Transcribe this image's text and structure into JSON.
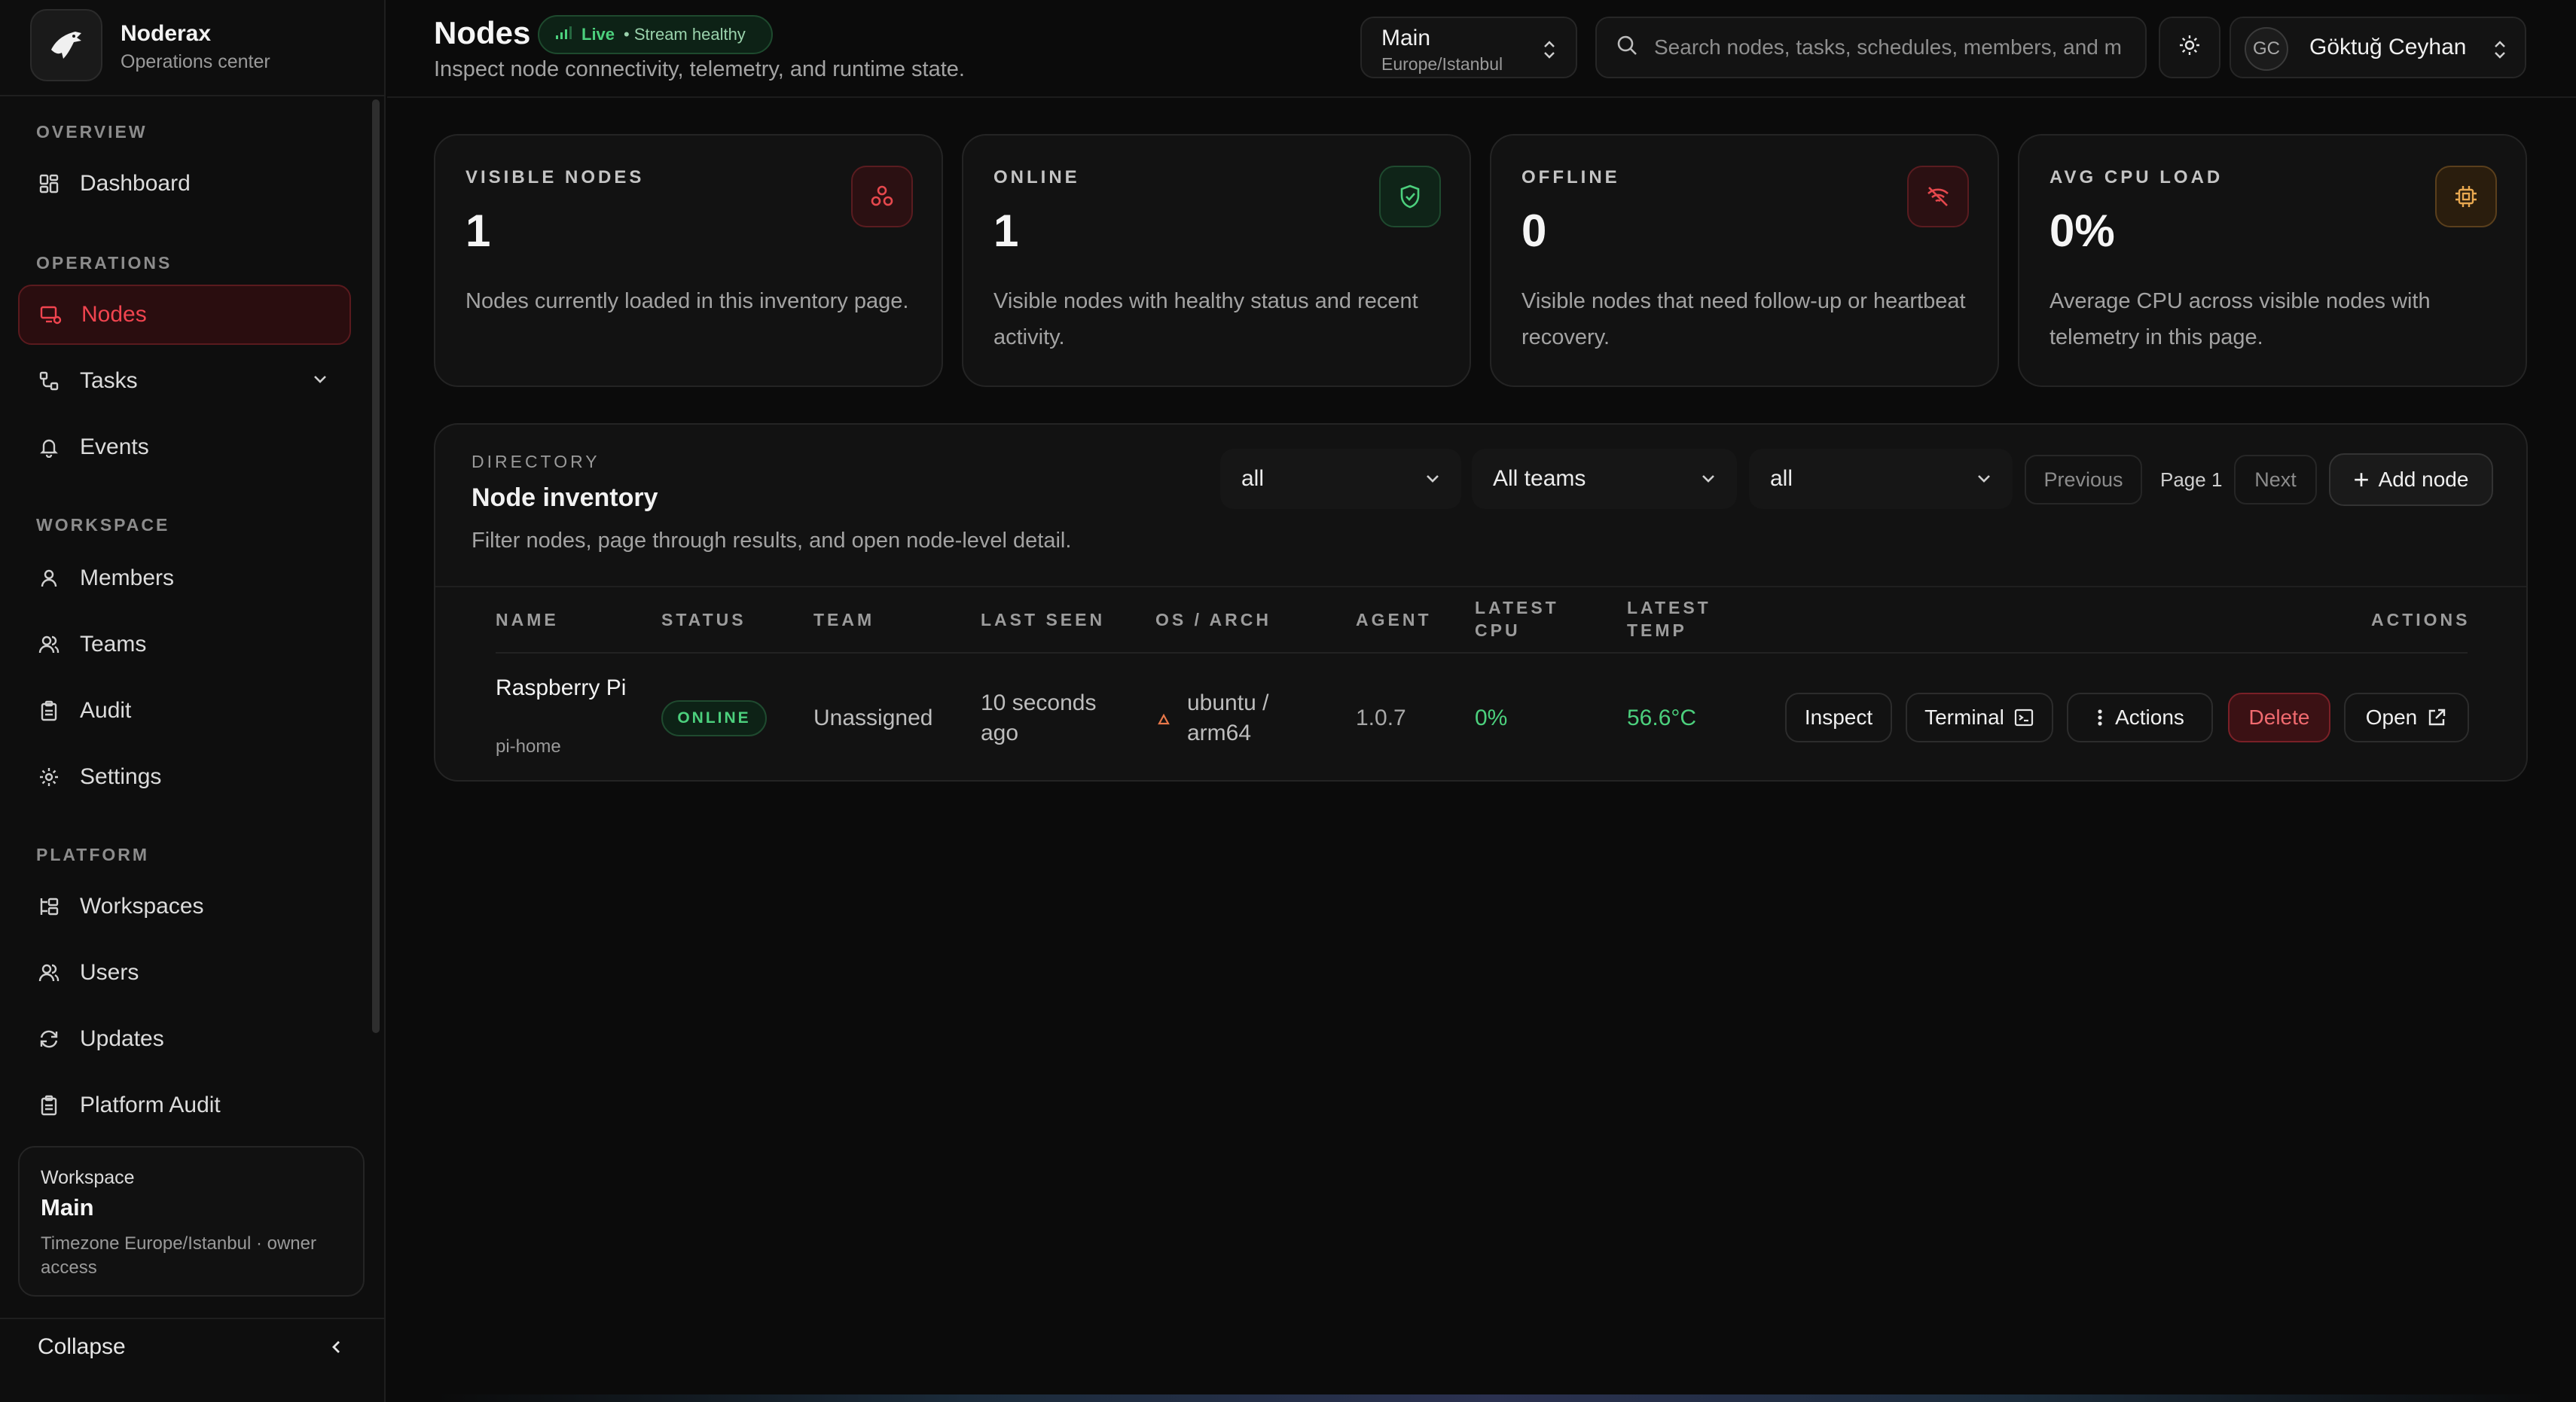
{
  "brand": {
    "name": "Noderax",
    "subtitle": "Operations center"
  },
  "sidebar": {
    "sections": [
      {
        "label": "OVERVIEW"
      },
      {
        "label": "OPERATIONS"
      },
      {
        "label": "WORKSPACE"
      },
      {
        "label": "PLATFORM"
      }
    ],
    "items": [
      {
        "label": "Dashboard",
        "icon": "dashboard-icon"
      },
      {
        "label": "Nodes",
        "icon": "nodes-icon",
        "active": true
      },
      {
        "label": "Tasks",
        "icon": "tasks-icon",
        "expandable": true
      },
      {
        "label": "Events",
        "icon": "bell-icon"
      },
      {
        "label": "Members",
        "icon": "user-icon"
      },
      {
        "label": "Teams",
        "icon": "users-icon"
      },
      {
        "label": "Audit",
        "icon": "clipboard-icon"
      },
      {
        "label": "Settings",
        "icon": "gear-icon"
      },
      {
        "label": "Workspaces",
        "icon": "workspaces-icon"
      },
      {
        "label": "Users",
        "icon": "users-icon"
      },
      {
        "label": "Updates",
        "icon": "refresh-icon"
      },
      {
        "label": "Platform Audit",
        "icon": "clipboard-icon"
      }
    ],
    "workspace_card": {
      "label": "Workspace",
      "name": "Main",
      "desc": "Timezone Europe/Istanbul · owner access"
    },
    "collapse_label": "Collapse"
  },
  "header": {
    "title": "Nodes",
    "live_label": "Live",
    "stream_label": "• Stream healthy",
    "subtitle": "Inspect node connectivity, telemetry, and runtime state.",
    "workspace_switch": {
      "name": "Main",
      "timezone": "Europe/Istanbul"
    },
    "search_placeholder": "Search nodes, tasks, schedules, members, and more",
    "user": {
      "initials": "GC",
      "name": "Göktuğ Ceyhan"
    }
  },
  "stats": [
    {
      "label": "VISIBLE NODES",
      "value": "1",
      "desc": "Nodes currently loaded in this inventory page.",
      "icon": "nodes-icon",
      "color": "#e5484d"
    },
    {
      "label": "ONLINE",
      "value": "1",
      "desc": "Visible nodes with healthy status and recent activity.",
      "icon": "shield-check-icon",
      "color": "#4cd07d"
    },
    {
      "label": "OFFLINE",
      "value": "0",
      "desc": "Visible nodes that need follow-up or heartbeat recovery.",
      "icon": "wifi-off-icon",
      "color": "#e5484d"
    },
    {
      "label": "AVG CPU LOAD",
      "value": "0%",
      "desc": "Average CPU across visible nodes with telemetry in this page.",
      "icon": "cpu-icon",
      "color": "#e8a850"
    }
  ],
  "inventory": {
    "kicker": "DIRECTORY",
    "title": "Node inventory",
    "desc": "Filter nodes, page through results, and open node-level detail.",
    "filters": {
      "status": "all",
      "team": "All teams",
      "os": "all"
    },
    "pagination": {
      "previous": "Previous",
      "page": "Page 1",
      "next": "Next"
    },
    "add_label": "Add node",
    "columns": [
      "NAME",
      "STATUS",
      "TEAM",
      "LAST SEEN",
      "OS / ARCH",
      "AGENT",
      "LATEST CPU",
      "LATEST TEMP",
      "ACTIONS"
    ],
    "rows": [
      {
        "name": "Raspberry Pi",
        "host": "pi-home",
        "status": "ONLINE",
        "team": "Unassigned",
        "last_seen": "10 seconds ago",
        "os_arch": "ubuntu / arm64",
        "agent": "1.0.7",
        "cpu": "0%",
        "temp": "56.6°C",
        "actions": {
          "inspect": "Inspect",
          "terminal": "Terminal",
          "more": "Actions",
          "delete": "Delete",
          "open": "Open"
        }
      }
    ]
  },
  "colors": {
    "accent": "#e5484d",
    "success": "#4cd07d",
    "warning": "#e8a850",
    "background": "#0b0b0b"
  }
}
